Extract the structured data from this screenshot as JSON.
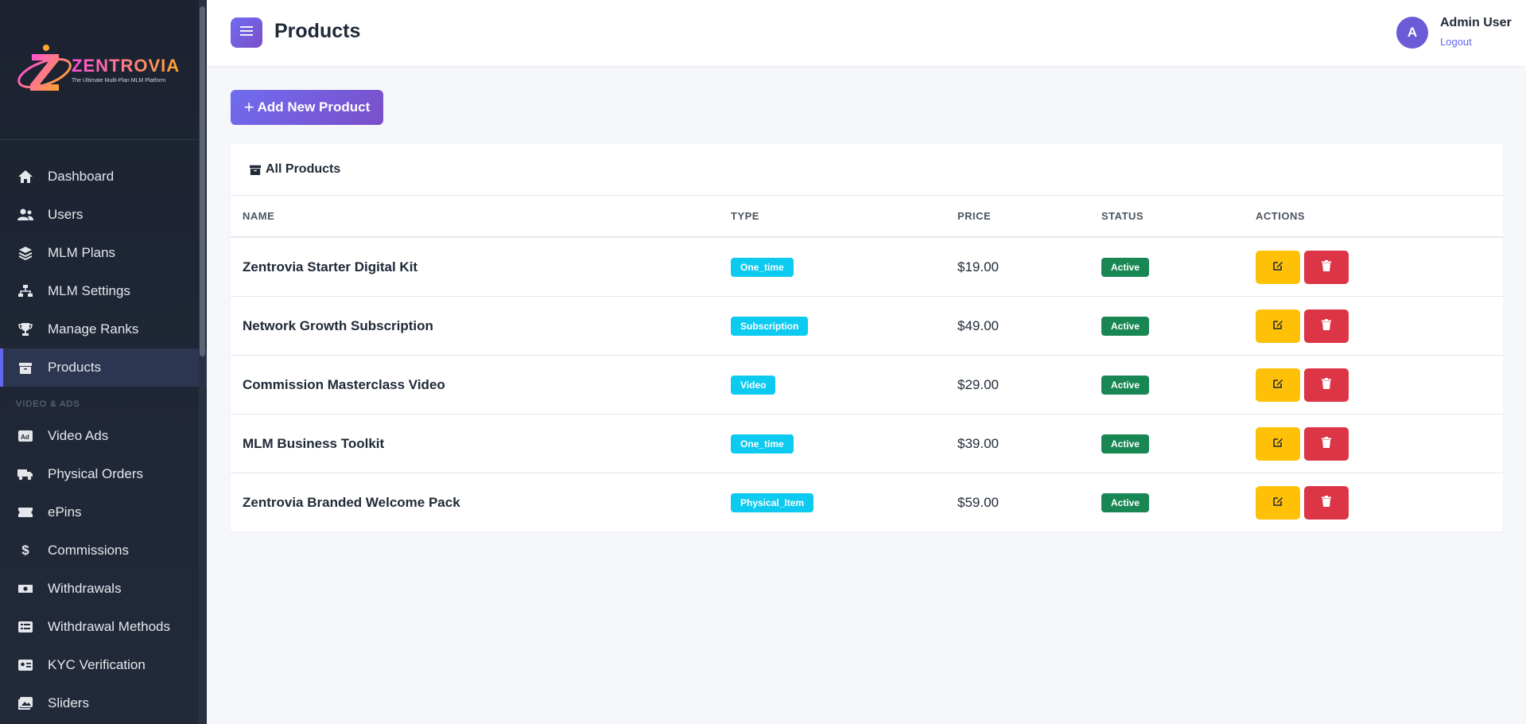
{
  "brand": {
    "name": "ZENTROVIA",
    "tagline": "The Ultimate Multi-Plan MLM Platform"
  },
  "sidebar": {
    "items": [
      {
        "label": "Dashboard",
        "icon": "home-icon"
      },
      {
        "label": "Users",
        "icon": "users-icon"
      },
      {
        "label": "MLM Plans",
        "icon": "layers-icon"
      },
      {
        "label": "MLM Settings",
        "icon": "sitemap-icon"
      },
      {
        "label": "Manage Ranks",
        "icon": "trophy-icon"
      },
      {
        "label": "Products",
        "icon": "box-icon",
        "active": true
      }
    ],
    "section_label": "VIDEO & ADS",
    "items2": [
      {
        "label": "Video Ads",
        "icon": "ad-icon"
      },
      {
        "label": "Physical Orders",
        "icon": "truck-icon"
      },
      {
        "label": "ePins",
        "icon": "ticket-icon"
      },
      {
        "label": "Commissions",
        "icon": "dollar-icon"
      },
      {
        "label": "Withdrawals",
        "icon": "money-icon"
      },
      {
        "label": "Withdrawal Methods",
        "icon": "list-card-icon"
      },
      {
        "label": "KYC Verification",
        "icon": "id-card-icon"
      },
      {
        "label": "Sliders",
        "icon": "image-icon"
      }
    ]
  },
  "header": {
    "title": "Products",
    "user": {
      "initial": "A",
      "name": "Admin User",
      "logout": "Logout"
    }
  },
  "actions": {
    "add_label": "Add New Product"
  },
  "card": {
    "title": "All Products",
    "columns": [
      "NAME",
      "TYPE",
      "PRICE",
      "STATUS",
      "ACTIONS"
    ],
    "rows": [
      {
        "name": "Zentrovia Starter Digital Kit",
        "type": "One_time",
        "price": "$19.00",
        "status": "Active"
      },
      {
        "name": "Network Growth Subscription",
        "type": "Subscription",
        "price": "$49.00",
        "status": "Active"
      },
      {
        "name": "Commission Masterclass Video",
        "type": "Video",
        "price": "$29.00",
        "status": "Active"
      },
      {
        "name": "MLM Business Toolkit",
        "type": "One_time",
        "price": "$39.00",
        "status": "Active"
      },
      {
        "name": "Zentrovia Branded Welcome Pack",
        "type": "Physical_Item",
        "price": "$59.00",
        "status": "Active"
      }
    ]
  },
  "colors": {
    "accent": "#6f6cf0",
    "edit": "#ffc107",
    "delete": "#dc3545",
    "type_badge": "#0dcaf0",
    "status_badge": "#198754"
  }
}
